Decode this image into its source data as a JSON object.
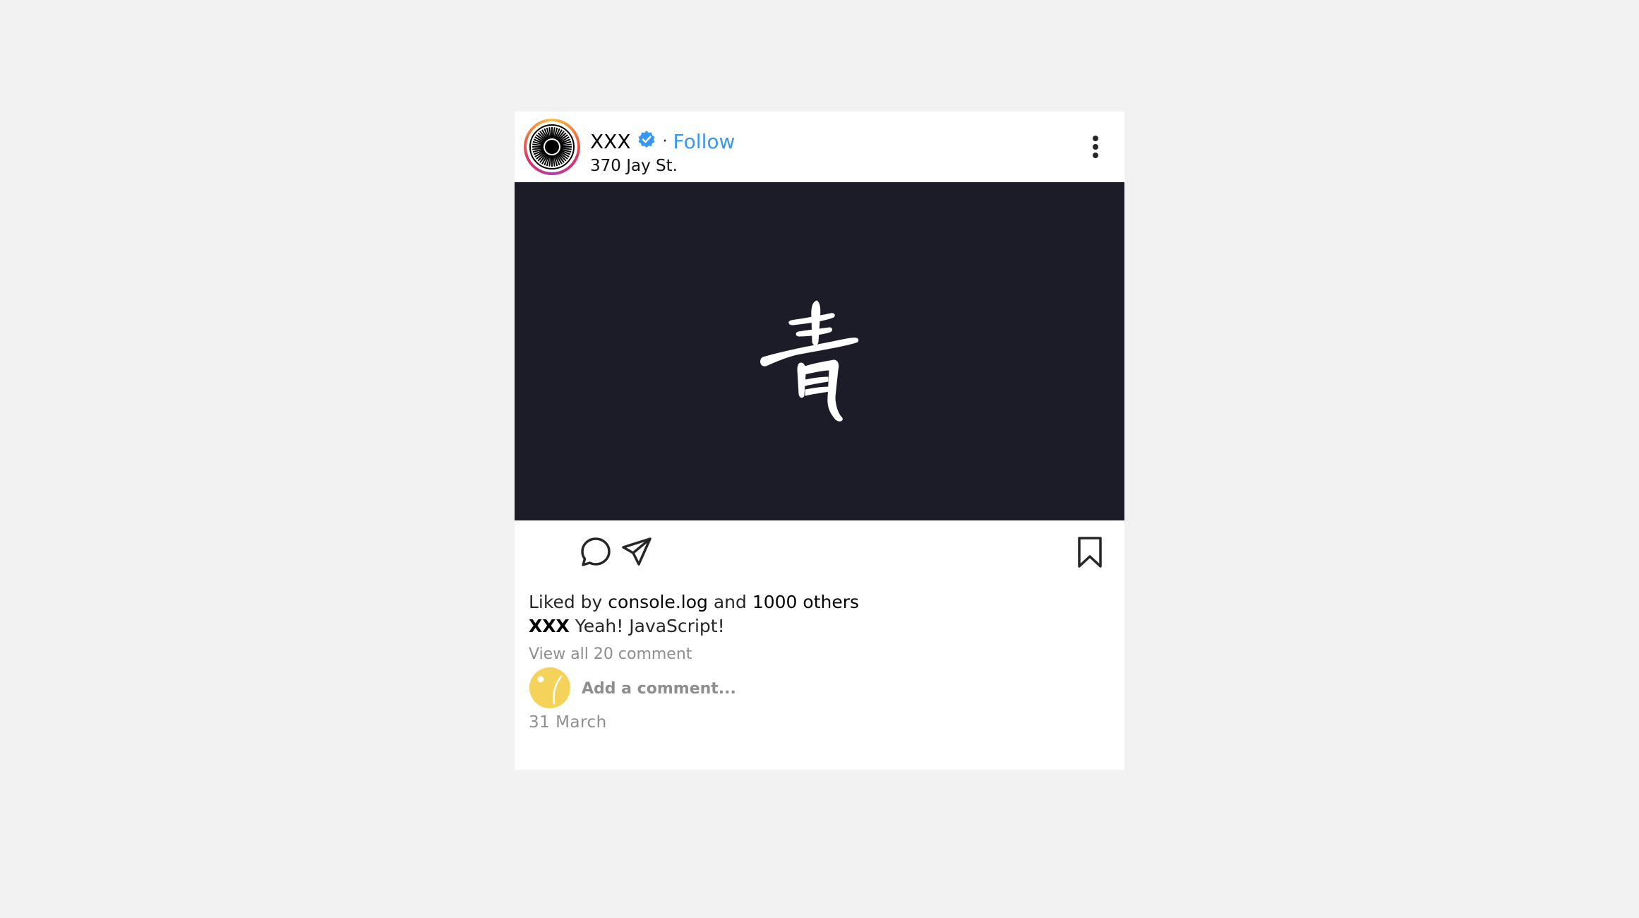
{
  "post": {
    "username": "XXX",
    "separator": "·",
    "follow_label": "Follow",
    "location": "370 Jay St.",
    "verified_icon": "verified-badge-icon",
    "more_icon": "more-options-icon",
    "media_glyph": "青",
    "likes": {
      "prefix": "Liked by",
      "first_liker": "console.log",
      "conjunction": "and",
      "others": "1000 others"
    },
    "caption": {
      "username": "XXX",
      "text": "Yeah! JavaScript!"
    },
    "view_all_comments": "View all 20 comment",
    "comment_placeholder": "Add a comment...",
    "date": "31 March"
  },
  "colors": {
    "background": "#f2f2f2",
    "card": "#ffffff",
    "media_background": "#1b1c27",
    "link_blue": "#3897f0",
    "muted_text": "#8e8e8e",
    "comment_avatar": "#f5d35a"
  }
}
